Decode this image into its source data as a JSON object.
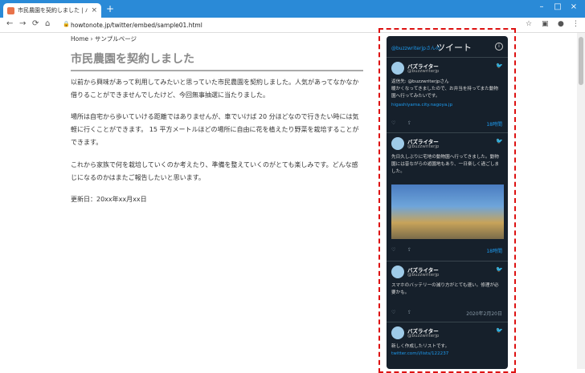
{
  "browser": {
    "tab_title": "市民農園を契約しました | バズブログ",
    "url": "howtonote.jp/twitter/embed/sample01.html"
  },
  "page": {
    "breadcrumb": "Home › サンプルページ",
    "title": "市民農園を契約しました",
    "paragraphs": [
      "以前から興味があって利用してみたいと思っていた市民農園を契約しました。人気があってなかなか借りることができませんでしたけど、今回無事抽選に当たりました。",
      "場所は自宅から歩いていける距離ではありませんが、車でいけば 20 分ほどなので行きたい時には気軽に行くことができます。 15 平方メートルほどの場所に自由に花を植えたり野菜を栽培することができます。",
      "これから家族で何を栽培していくのか考えたり、準備を整えていくのがとても楽しみです。どんな感じになるのかはまたご報告したいと思います。",
      "更新日：20xx年xx月xx日"
    ]
  },
  "widget": {
    "user_link": "@buzzwriterjpさんの",
    "title": "ツイート",
    "tweets": [
      {
        "name": "バズライター",
        "handle": "@buzzwriterjp",
        "text": "返信先: @buzzwriterjpさん\n暖かくなってきましたので、お弁当を持ってまた動物園へ行ってみたいです。",
        "link": "higashiyama.city.nagoya.jp",
        "date": "18時間"
      },
      {
        "name": "バズライター",
        "handle": "@buzzwriterjp",
        "text": "先日久しぶりに宅地の動物園へ行ってきました。動物園には昔ながらの遊園地もあり、一日楽しく過ごしました。",
        "date": "18時間"
      },
      {
        "name": "バズライター",
        "handle": "@buzzwriterjp",
        "text": "スマホのバッテリーの減り方がとても速い。修理が必要かも。",
        "date": "2020年2月20日"
      },
      {
        "name": "バズライター",
        "handle": "@buzzwriterjp",
        "text": "新しく作成したリストです。",
        "link": "twitter.com/i/lists/122237"
      }
    ]
  },
  "icons": {
    "back": "arrow-left-icon",
    "forward": "arrow-right-icon",
    "reload": "reload-icon",
    "home": "home-icon",
    "star": "star-icon",
    "profile": "profile-icon",
    "menu": "kebab-menu-icon"
  }
}
